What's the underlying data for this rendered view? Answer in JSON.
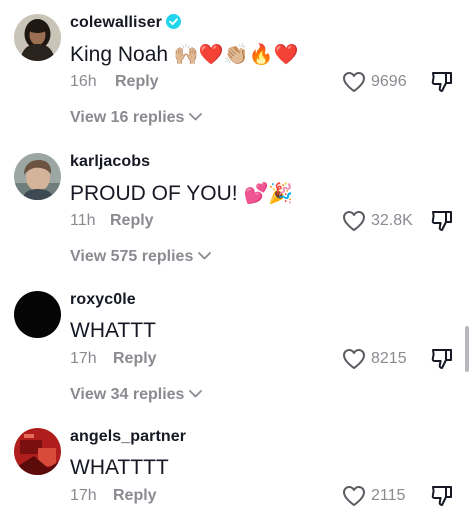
{
  "comments": [
    {
      "username": "colewalliser",
      "verified": true,
      "text": "King Noah",
      "emojis": "🙌🏼❤️👏🏼🔥❤️",
      "time": "16h",
      "reply_label": "Reply",
      "likes": "9696",
      "view_replies": "View 16 replies"
    },
    {
      "username": "karljacobs",
      "verified": false,
      "text": "PROUD OF YOU!",
      "emojis": "💕🎉",
      "time": "11h",
      "reply_label": "Reply",
      "likes": "32.8K",
      "view_replies": "View 575 replies"
    },
    {
      "username": "roxyc0le",
      "verified": false,
      "text": "WHATTT",
      "emojis": "",
      "time": "17h",
      "reply_label": "Reply",
      "likes": "8215",
      "view_replies": "View 34 replies"
    },
    {
      "username": "angels_partner",
      "verified": false,
      "text": "WHATTTT",
      "emojis": "",
      "time": "17h",
      "reply_label": "Reply",
      "likes": "2115",
      "view_replies": ""
    }
  ],
  "colors": {
    "text": "#161823",
    "secondary": "#8a8b91",
    "verified": "#20d5ec"
  }
}
